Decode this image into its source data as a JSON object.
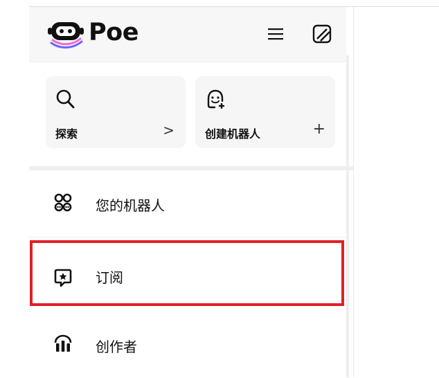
{
  "app": {
    "name": "Poe",
    "brand_color": "#6c2bd9"
  },
  "header": {
    "title": "Poe",
    "menu_icon": "hamburger-menu-icon",
    "new_chat_icon": "edit-slash-icon"
  },
  "cards": [
    {
      "label": "探索",
      "icon": "search-icon",
      "trailing": ">"
    },
    {
      "label": "创建机器人",
      "icon": "bot-plus-icon",
      "trailing": "+"
    }
  ],
  "nav": {
    "items": [
      {
        "label": "您的机器人",
        "icon": "bots-grid-icon"
      },
      {
        "label": "订阅",
        "icon": "star-bubble-icon",
        "highlighted": true
      },
      {
        "label": "创作者",
        "icon": "creators-icon"
      }
    ]
  },
  "highlight_color": "#e02028"
}
